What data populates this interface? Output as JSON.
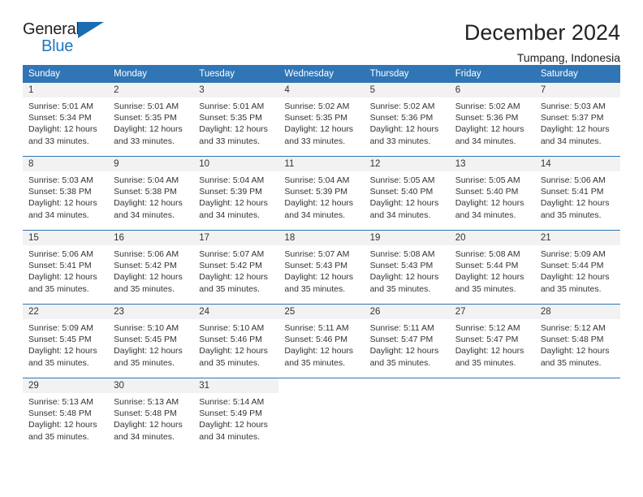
{
  "logo": {
    "primary_text": "General",
    "secondary_text": "Blue",
    "primary_color": "#231f20",
    "secondary_color": "#1f77bd",
    "triangle_color": "#1b6cb0",
    "triangle_icon": "triangle-icon"
  },
  "header": {
    "title": "December 2024",
    "subtitle": "Tumpang, Indonesia"
  },
  "theme": {
    "header_blue": "#3075b5",
    "daynum_background": "#f2f2f2",
    "text": "#333333"
  },
  "weekdays": [
    "Sunday",
    "Monday",
    "Tuesday",
    "Wednesday",
    "Thursday",
    "Friday",
    "Saturday"
  ],
  "weeks": [
    [
      {
        "day": "1",
        "sunrise": "Sunrise: 5:01 AM",
        "sunset": "Sunset: 5:34 PM",
        "daylight1": "Daylight: 12 hours",
        "daylight2": "and 33 minutes."
      },
      {
        "day": "2",
        "sunrise": "Sunrise: 5:01 AM",
        "sunset": "Sunset: 5:35 PM",
        "daylight1": "Daylight: 12 hours",
        "daylight2": "and 33 minutes."
      },
      {
        "day": "3",
        "sunrise": "Sunrise: 5:01 AM",
        "sunset": "Sunset: 5:35 PM",
        "daylight1": "Daylight: 12 hours",
        "daylight2": "and 33 minutes."
      },
      {
        "day": "4",
        "sunrise": "Sunrise: 5:02 AM",
        "sunset": "Sunset: 5:35 PM",
        "daylight1": "Daylight: 12 hours",
        "daylight2": "and 33 minutes."
      },
      {
        "day": "5",
        "sunrise": "Sunrise: 5:02 AM",
        "sunset": "Sunset: 5:36 PM",
        "daylight1": "Daylight: 12 hours",
        "daylight2": "and 33 minutes."
      },
      {
        "day": "6",
        "sunrise": "Sunrise: 5:02 AM",
        "sunset": "Sunset: 5:36 PM",
        "daylight1": "Daylight: 12 hours",
        "daylight2": "and 34 minutes."
      },
      {
        "day": "7",
        "sunrise": "Sunrise: 5:03 AM",
        "sunset": "Sunset: 5:37 PM",
        "daylight1": "Daylight: 12 hours",
        "daylight2": "and 34 minutes."
      }
    ],
    [
      {
        "day": "8",
        "sunrise": "Sunrise: 5:03 AM",
        "sunset": "Sunset: 5:38 PM",
        "daylight1": "Daylight: 12 hours",
        "daylight2": "and 34 minutes."
      },
      {
        "day": "9",
        "sunrise": "Sunrise: 5:04 AM",
        "sunset": "Sunset: 5:38 PM",
        "daylight1": "Daylight: 12 hours",
        "daylight2": "and 34 minutes."
      },
      {
        "day": "10",
        "sunrise": "Sunrise: 5:04 AM",
        "sunset": "Sunset: 5:39 PM",
        "daylight1": "Daylight: 12 hours",
        "daylight2": "and 34 minutes."
      },
      {
        "day": "11",
        "sunrise": "Sunrise: 5:04 AM",
        "sunset": "Sunset: 5:39 PM",
        "daylight1": "Daylight: 12 hours",
        "daylight2": "and 34 minutes."
      },
      {
        "day": "12",
        "sunrise": "Sunrise: 5:05 AM",
        "sunset": "Sunset: 5:40 PM",
        "daylight1": "Daylight: 12 hours",
        "daylight2": "and 34 minutes."
      },
      {
        "day": "13",
        "sunrise": "Sunrise: 5:05 AM",
        "sunset": "Sunset: 5:40 PM",
        "daylight1": "Daylight: 12 hours",
        "daylight2": "and 34 minutes."
      },
      {
        "day": "14",
        "sunrise": "Sunrise: 5:06 AM",
        "sunset": "Sunset: 5:41 PM",
        "daylight1": "Daylight: 12 hours",
        "daylight2": "and 35 minutes."
      }
    ],
    [
      {
        "day": "15",
        "sunrise": "Sunrise: 5:06 AM",
        "sunset": "Sunset: 5:41 PM",
        "daylight1": "Daylight: 12 hours",
        "daylight2": "and 35 minutes."
      },
      {
        "day": "16",
        "sunrise": "Sunrise: 5:06 AM",
        "sunset": "Sunset: 5:42 PM",
        "daylight1": "Daylight: 12 hours",
        "daylight2": "and 35 minutes."
      },
      {
        "day": "17",
        "sunrise": "Sunrise: 5:07 AM",
        "sunset": "Sunset: 5:42 PM",
        "daylight1": "Daylight: 12 hours",
        "daylight2": "and 35 minutes."
      },
      {
        "day": "18",
        "sunrise": "Sunrise: 5:07 AM",
        "sunset": "Sunset: 5:43 PM",
        "daylight1": "Daylight: 12 hours",
        "daylight2": "and 35 minutes."
      },
      {
        "day": "19",
        "sunrise": "Sunrise: 5:08 AM",
        "sunset": "Sunset: 5:43 PM",
        "daylight1": "Daylight: 12 hours",
        "daylight2": "and 35 minutes."
      },
      {
        "day": "20",
        "sunrise": "Sunrise: 5:08 AM",
        "sunset": "Sunset: 5:44 PM",
        "daylight1": "Daylight: 12 hours",
        "daylight2": "and 35 minutes."
      },
      {
        "day": "21",
        "sunrise": "Sunrise: 5:09 AM",
        "sunset": "Sunset: 5:44 PM",
        "daylight1": "Daylight: 12 hours",
        "daylight2": "and 35 minutes."
      }
    ],
    [
      {
        "day": "22",
        "sunrise": "Sunrise: 5:09 AM",
        "sunset": "Sunset: 5:45 PM",
        "daylight1": "Daylight: 12 hours",
        "daylight2": "and 35 minutes."
      },
      {
        "day": "23",
        "sunrise": "Sunrise: 5:10 AM",
        "sunset": "Sunset: 5:45 PM",
        "daylight1": "Daylight: 12 hours",
        "daylight2": "and 35 minutes."
      },
      {
        "day": "24",
        "sunrise": "Sunrise: 5:10 AM",
        "sunset": "Sunset: 5:46 PM",
        "daylight1": "Daylight: 12 hours",
        "daylight2": "and 35 minutes."
      },
      {
        "day": "25",
        "sunrise": "Sunrise: 5:11 AM",
        "sunset": "Sunset: 5:46 PM",
        "daylight1": "Daylight: 12 hours",
        "daylight2": "and 35 minutes."
      },
      {
        "day": "26",
        "sunrise": "Sunrise: 5:11 AM",
        "sunset": "Sunset: 5:47 PM",
        "daylight1": "Daylight: 12 hours",
        "daylight2": "and 35 minutes."
      },
      {
        "day": "27",
        "sunrise": "Sunrise: 5:12 AM",
        "sunset": "Sunset: 5:47 PM",
        "daylight1": "Daylight: 12 hours",
        "daylight2": "and 35 minutes."
      },
      {
        "day": "28",
        "sunrise": "Sunrise: 5:12 AM",
        "sunset": "Sunset: 5:48 PM",
        "daylight1": "Daylight: 12 hours",
        "daylight2": "and 35 minutes."
      }
    ],
    [
      {
        "day": "29",
        "sunrise": "Sunrise: 5:13 AM",
        "sunset": "Sunset: 5:48 PM",
        "daylight1": "Daylight: 12 hours",
        "daylight2": "and 35 minutes."
      },
      {
        "day": "30",
        "sunrise": "Sunrise: 5:13 AM",
        "sunset": "Sunset: 5:48 PM",
        "daylight1": "Daylight: 12 hours",
        "daylight2": "and 34 minutes."
      },
      {
        "day": "31",
        "sunrise": "Sunrise: 5:14 AM",
        "sunset": "Sunset: 5:49 PM",
        "daylight1": "Daylight: 12 hours",
        "daylight2": "and 34 minutes."
      },
      {
        "day": "",
        "sunrise": "",
        "sunset": "",
        "daylight1": "",
        "daylight2": ""
      },
      {
        "day": "",
        "sunrise": "",
        "sunset": "",
        "daylight1": "",
        "daylight2": ""
      },
      {
        "day": "",
        "sunrise": "",
        "sunset": "",
        "daylight1": "",
        "daylight2": ""
      },
      {
        "day": "",
        "sunrise": "",
        "sunset": "",
        "daylight1": "",
        "daylight2": ""
      }
    ]
  ]
}
